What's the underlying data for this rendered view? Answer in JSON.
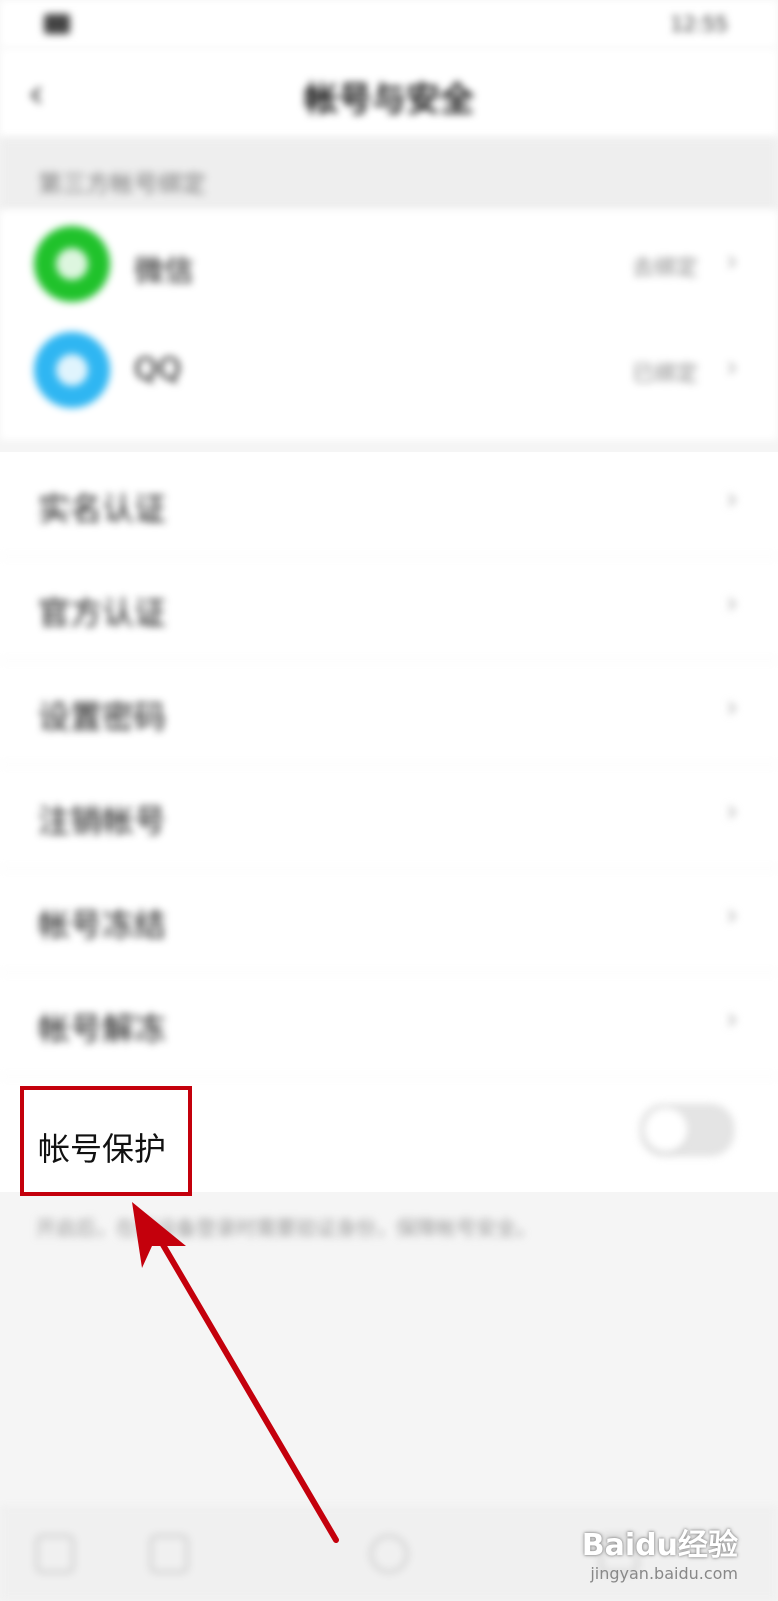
{
  "status_bar": {
    "time": "12:55"
  },
  "nav": {
    "title": "帐号与安全"
  },
  "bind_section": {
    "header": "第三方帐号绑定",
    "items": [
      {
        "label": "微信",
        "status": "去绑定"
      },
      {
        "label": "QQ",
        "status": "已绑定"
      }
    ]
  },
  "settings": {
    "rows": [
      {
        "label": "实名认证"
      },
      {
        "label": "官方认证"
      },
      {
        "label": "设置密码"
      },
      {
        "label": "注销帐号"
      },
      {
        "label": "帐号冻结"
      },
      {
        "label": "帐号解冻"
      }
    ],
    "protect": {
      "label": "帐号保护",
      "enabled": false
    },
    "footnote": "开启后，在新设备登录时需要验证身份，保障帐号安全。"
  },
  "annotation": {
    "color": "#c4000c"
  },
  "watermark": {
    "brand": "Baidu经验",
    "url": "jingyan.baidu.com"
  }
}
